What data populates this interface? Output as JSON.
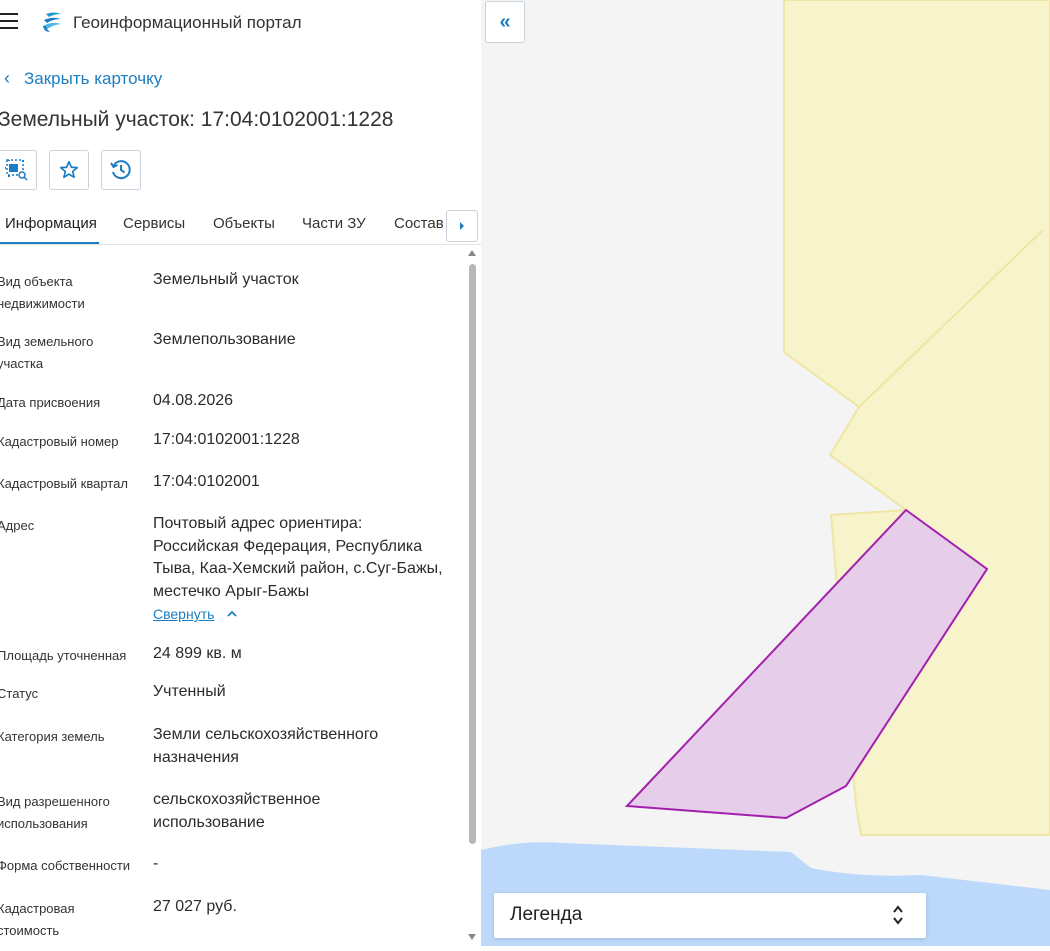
{
  "header": {
    "portal_title": "Геоинформационный портал"
  },
  "card": {
    "close_label": "Закрыть карточку",
    "title": "Земельный участок: 17:04:0102001:1228"
  },
  "tabs": [
    {
      "label": "Информация"
    },
    {
      "label": "Сервисы"
    },
    {
      "label": "Объекты"
    },
    {
      "label": "Части ЗУ"
    },
    {
      "label": "Состав"
    }
  ],
  "properties": [
    {
      "label": "Вид объекта недвижимости",
      "value": "Земельный участок"
    },
    {
      "label": "Вид земельного участка",
      "value": "Землепользование"
    },
    {
      "label": "Дата присвоения",
      "value": "04.08.2026"
    },
    {
      "label": "Кадастровый номер",
      "value": "17:04:0102001:1228"
    },
    {
      "label": "Кадастровый квартал",
      "value": "17:04:0102001"
    },
    {
      "label": "Адрес",
      "value": "Почтовый адрес ориентира: Российская Федерация, Республика Тыва, Каа-Хемский район, с.Суг-Бажы, местечко Арыг-Бажы"
    },
    {
      "label": "Площадь уточненная",
      "value": "24 899 кв. м"
    },
    {
      "label": "Статус",
      "value": "Учтенный"
    },
    {
      "label": "Категория земель",
      "value": "Земли сельскохозяйственного назначения"
    },
    {
      "label": "Вид разрешенного использования",
      "value": "сельскохозяйственное использование"
    },
    {
      "label": "Форма собственности",
      "value": "-"
    },
    {
      "label": "Кадастровая стоимость",
      "value": "27 027 руб."
    }
  ],
  "address_collapse_label": "Свернуть",
  "map": {
    "legend_label": "Легенда",
    "colors": {
      "background": "#f4f4f4",
      "zone": "#f7f3cb",
      "zone_border": "#efe6a4",
      "parcel_fill": "#e6cde9",
      "parcel_border": "#a21fad",
      "water": "#bcd9fb"
    }
  },
  "colors": {
    "accent": "#1d7dc2"
  }
}
